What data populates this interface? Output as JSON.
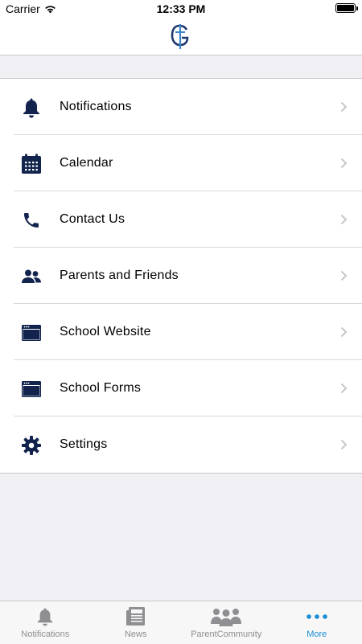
{
  "status_bar": {
    "carrier": "Carrier",
    "time": "12:33 PM"
  },
  "header": {
    "logo": "school-crest-logo"
  },
  "menu": {
    "items": [
      {
        "label": "Notifications",
        "icon": "bell-icon"
      },
      {
        "label": "Calendar",
        "icon": "calendar-icon"
      },
      {
        "label": "Contact Us",
        "icon": "phone-icon"
      },
      {
        "label": "Parents and Friends",
        "icon": "people-icon"
      },
      {
        "label": "School Website",
        "icon": "browser-window-icon"
      },
      {
        "label": "School Forms",
        "icon": "browser-window-icon"
      },
      {
        "label": "Settings",
        "icon": "gear-icon"
      }
    ]
  },
  "tab_bar": {
    "tabs": [
      {
        "label": "Notifications",
        "icon": "bell-icon",
        "active": false
      },
      {
        "label": "News",
        "icon": "newspaper-icon",
        "active": false
      },
      {
        "label": "ParentCommunity",
        "icon": "group-icon",
        "active": false
      },
      {
        "label": "More",
        "icon": "more-dots-icon",
        "active": true
      }
    ]
  },
  "colors": {
    "icon_navy": "#12234d",
    "accent_blue": "#1a8fd6",
    "tab_inactive": "#8e8e93",
    "background": "#efeff4"
  }
}
